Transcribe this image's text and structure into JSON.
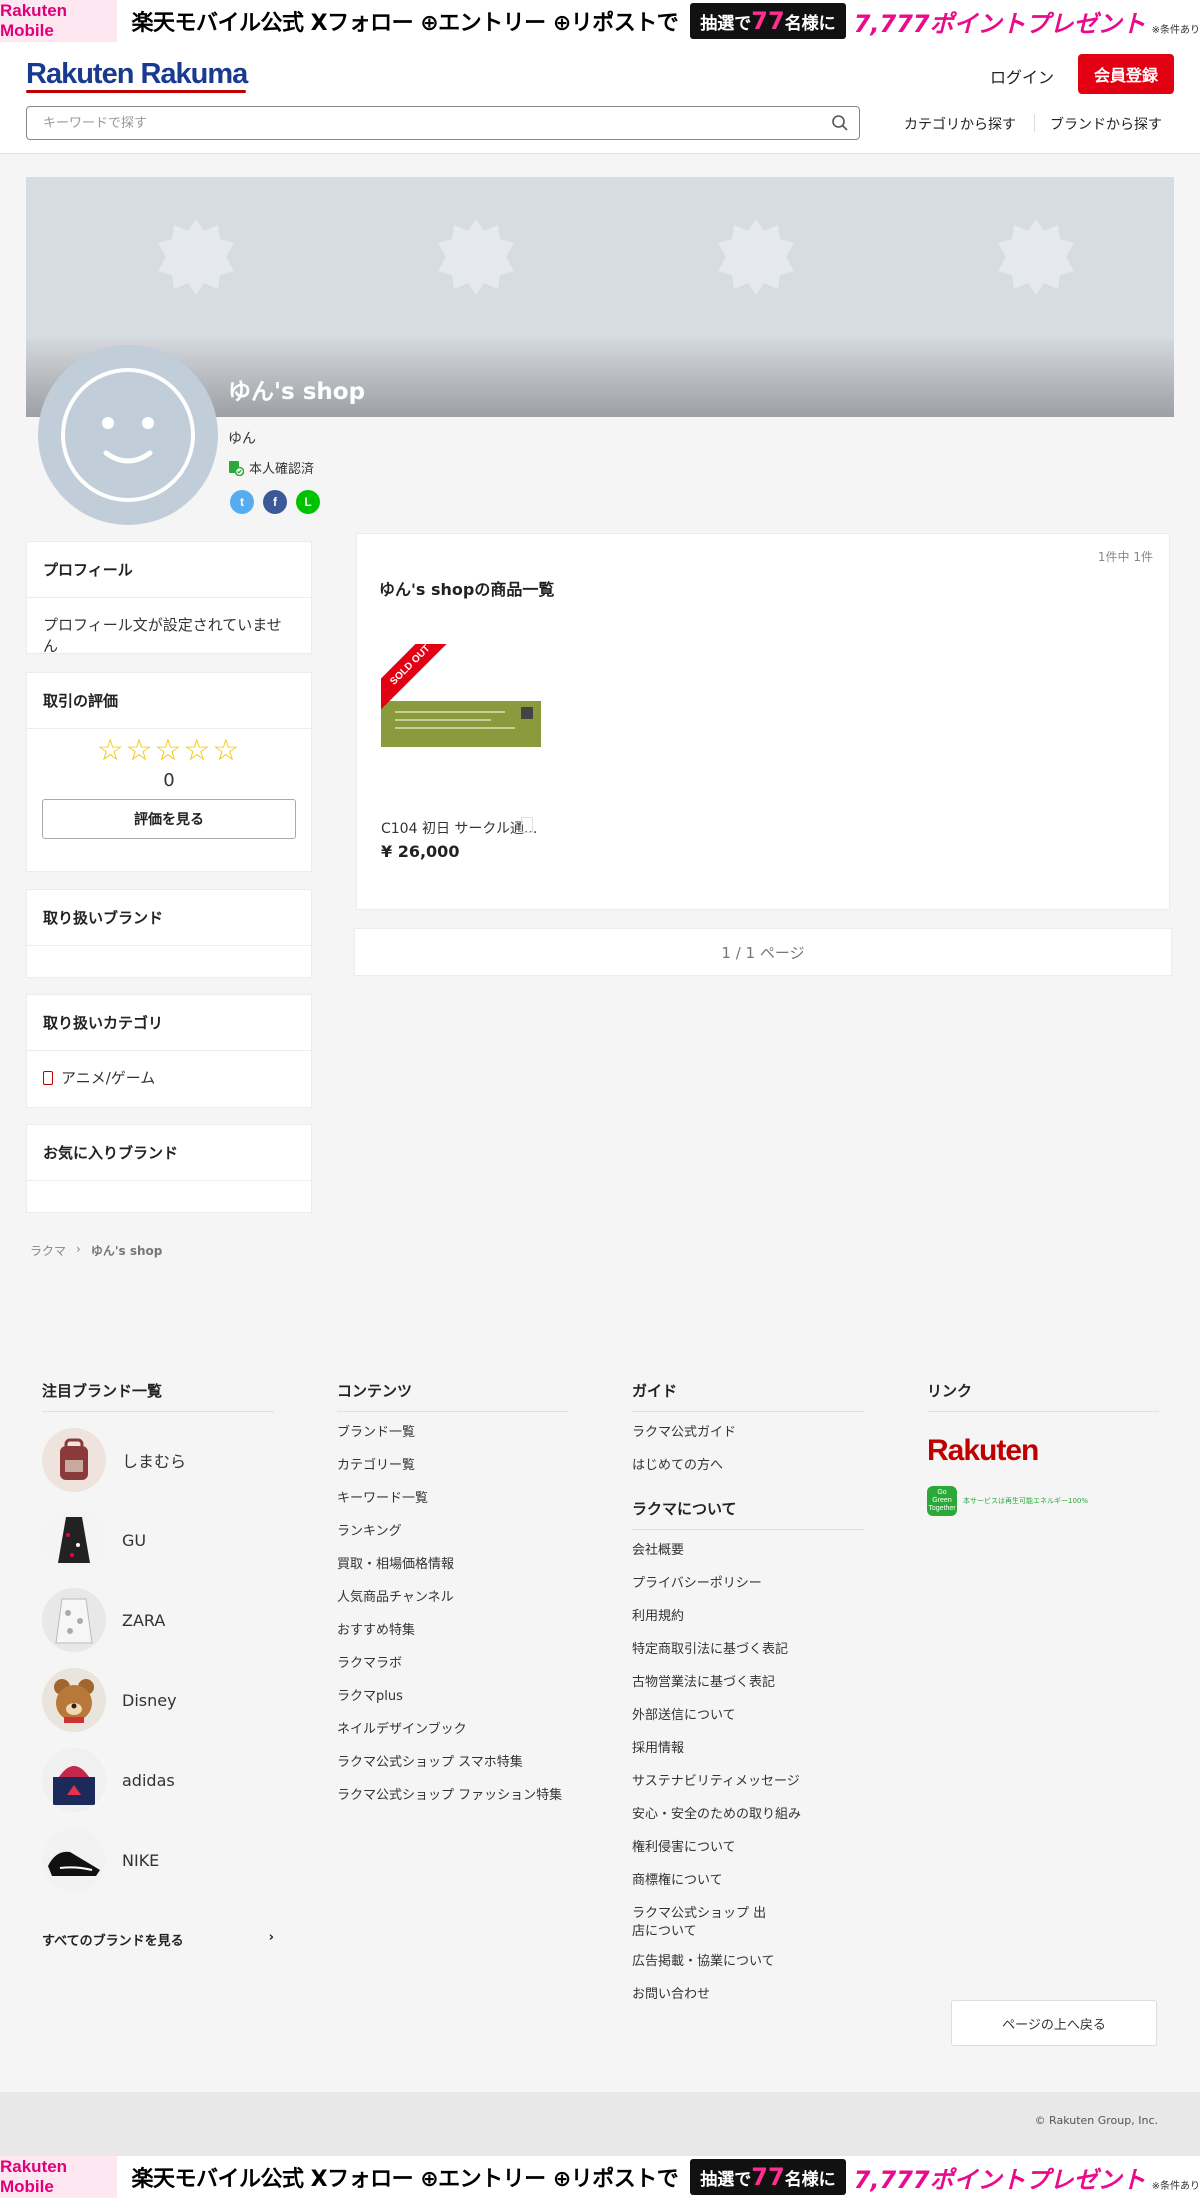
{
  "promo": {
    "mobile_logo": "Rakuten Mobile",
    "text": "楽天モバイル公式 Xフォロー ⊕エントリー ⊕リポストで",
    "lottery_prefix": "抽選で",
    "lottery_count": "77",
    "lottery_suffix": "名様に",
    "points": "7,777ポイントプレゼント",
    "note": "※条件あり"
  },
  "header": {
    "logo": "Rakuten Rakuma",
    "login": "ログイン",
    "signup": "会員登録",
    "search_placeholder": "キーワードで探す",
    "nav_category": "カテゴリから探す",
    "nav_brand": "ブランドから探す"
  },
  "profile": {
    "shop_name": "ゆん's shop",
    "owner_name": "ゆん",
    "verified_label": "本人確認済",
    "social": [
      "twitter",
      "facebook",
      "line"
    ]
  },
  "sidebar": {
    "profile_title": "プロフィール",
    "profile_text": "プロフィール文が設定されていません",
    "rating_title": "取引の評価",
    "rating_stars": "☆☆☆☆☆",
    "rating_count": "0",
    "review_button": "評価を見る",
    "brands_title": "取り扱いブランド",
    "categories_title": "取り扱いカテゴリ",
    "category_item": "アニメ/ゲーム",
    "fav_brands_title": "お気に入りブランド"
  },
  "products": {
    "count": "1件中 1件",
    "title": "ゆん's shopの商品一覧",
    "items": [
      {
        "name": "C104 初日 サークル通...",
        "price": "¥ 26,000",
        "badge": "SOLD OUT"
      }
    ],
    "pager": "1 / 1 ページ"
  },
  "breadcrumb": {
    "home": "ラクマ",
    "current": "ゆん's shop"
  },
  "footer": {
    "brands_title": "注目ブランド一覧",
    "brands": [
      "しまむら",
      "GU",
      "ZARA",
      "Disney",
      "adidas",
      "NIKE"
    ],
    "all_brands": "すべてのブランドを見る",
    "contents_title": "コンテンツ",
    "contents": [
      "ブランド一覧",
      "カテゴリー覧",
      "キーワード一覧",
      "ランキング",
      "買取・相場価格情報",
      "人気商品チャンネル",
      "おすすめ特集",
      "ラクマラボ",
      "ラクマplus",
      "ネイルデザインブック",
      "ラクマ公式ショップ スマホ特集",
      "ラクマ公式ショップ ファッション特集"
    ],
    "guide_title": "ガイド",
    "guide": [
      "ラクマ公式ガイド",
      "はじめての方へ"
    ],
    "about_title": "ラクマについて",
    "about": [
      "会社概要",
      "プライバシーポリシー",
      "利用規約",
      "特定商取引法に基づく表記",
      "古物営業法に基づく表記",
      "外部送信について",
      "採用情報",
      "サステナビリティメッセージ",
      "安心・安全のための取り組み",
      "権利侵害について",
      "商標権について",
      "ラクマ公式ショップ 出店について",
      "広告掲載・協業について",
      "お問い合わせ"
    ],
    "links_title": "リンク",
    "rakuten_logo": "Rakuten",
    "green_badge_icon": "Go Green Together",
    "green_badge_text": "本サービスは再生可能エネルギー100%",
    "back_to_top": "ページの上へ戻る",
    "copyright": "© Rakuten Group, Inc."
  }
}
